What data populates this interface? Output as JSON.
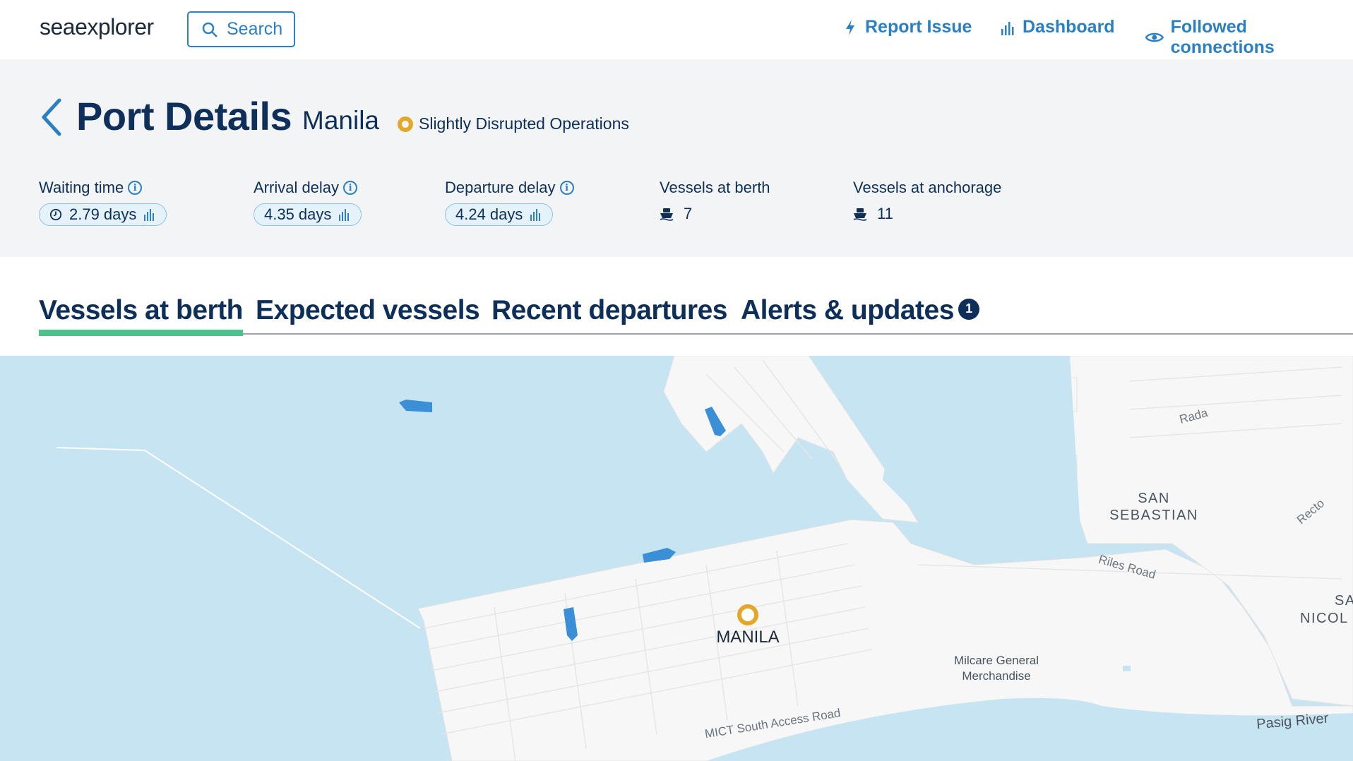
{
  "topbar": {
    "logo": "seaexplorer",
    "search_label": "Search",
    "report_issue": "Report Issue",
    "dashboard": "Dashboard",
    "followed": "Followed connections"
  },
  "header": {
    "title": "Port Details",
    "port": "Manila",
    "status": "Slightly Disrupted Operations",
    "status_color": "#e3a82b"
  },
  "metrics": {
    "waiting": {
      "label": "Waiting time",
      "value": "2.79 days"
    },
    "arrival": {
      "label": "Arrival delay",
      "value": "4.35 days"
    },
    "departure": {
      "label": "Departure delay",
      "value": "4.24 days"
    },
    "berth": {
      "label": "Vessels at berth",
      "value": "7"
    },
    "anchorage": {
      "label": "Vessels at anchorage",
      "value": "11"
    }
  },
  "tabs": {
    "berth": "Vessels at berth",
    "expected": "Expected vessels",
    "departures": "Recent departures",
    "alerts": "Alerts & updates",
    "alerts_count": "1"
  },
  "map": {
    "port_label": "MANILA",
    "san_sebastian_1": "SAN",
    "san_sebastian_2": "SEBASTIAN",
    "san_nicolas_1": "SAN",
    "san_nicolas_2": "NICOL",
    "rada": "Rada",
    "recto": "Recto",
    "riles_road": "Riles Road",
    "milcare_1": "Milcare General",
    "milcare_2": "Merchandise",
    "mict_road": "MICT South Access Road",
    "pasig_river": "Pasig River",
    "water_color": "#c7e4f2",
    "land_color": "#f7f7f7",
    "vessel_color": "#3a8fd6"
  }
}
